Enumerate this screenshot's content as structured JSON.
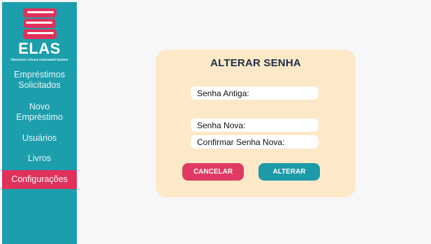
{
  "brand": {
    "name": "ELAS",
    "tagline": "Electronic Library Automated System"
  },
  "sidebar": {
    "items": [
      {
        "line1": "Empréstimos",
        "line2": "Solicitados"
      },
      {
        "line1": "Novo",
        "line2": "Empréstimo"
      },
      {
        "line1": "Usuários"
      },
      {
        "line1": "Livros"
      },
      {
        "line1": "Configurações",
        "active": true
      }
    ]
  },
  "form": {
    "title": "ALTERAR SENHA",
    "old_password_placeholder": "Senha Antiga:",
    "new_password_placeholder": "Senha Nova:",
    "confirm_password_placeholder": "Confirmar Senha Nova:",
    "cancel_label": "CANCELAR",
    "submit_label": "ALTERAR"
  },
  "colors": {
    "sidebar": "#1c9eac",
    "active": "#e0315b",
    "card": "#fde9c7",
    "cancel": "#de3a63",
    "submit": "#1d9aa8"
  }
}
